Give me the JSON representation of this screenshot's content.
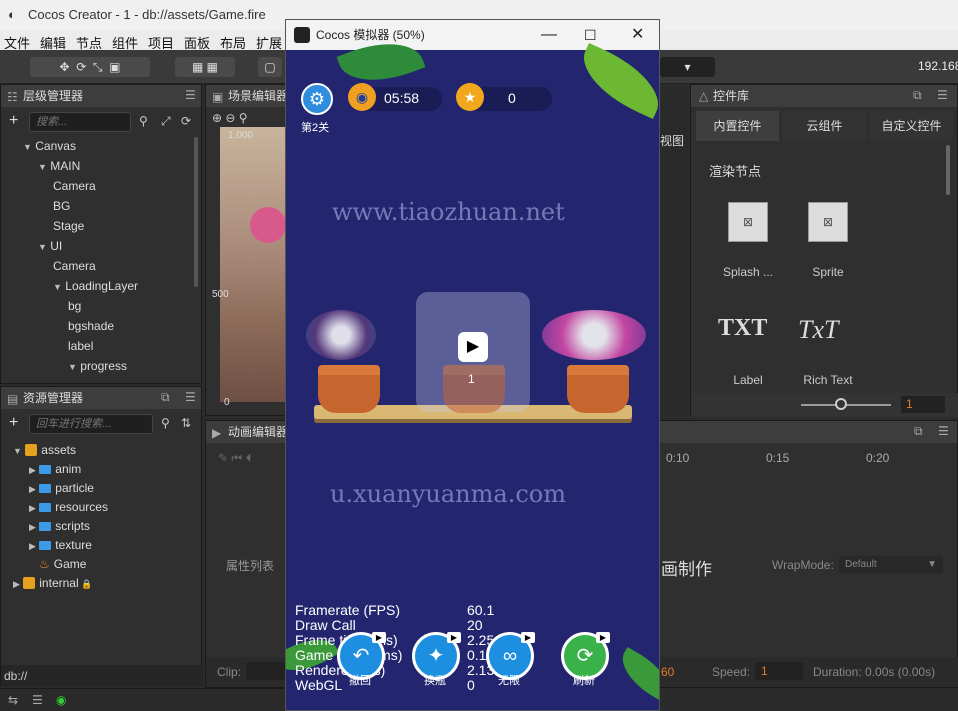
{
  "app": {
    "title": "Cocos Creator - 1 - db://assets/Game.fire",
    "ip": "192.168"
  },
  "menu": [
    "文件",
    "编辑",
    "节点",
    "组件",
    "项目",
    "面板",
    "布局",
    "扩展"
  ],
  "hierarchy": {
    "title": "层级管理器",
    "search_placeholder": "搜索...",
    "items": [
      {
        "label": "Canvas",
        "depth": 0,
        "open": true
      },
      {
        "label": "MAIN",
        "depth": 1,
        "open": true
      },
      {
        "label": "Camera",
        "depth": 2
      },
      {
        "label": "BG",
        "depth": 2
      },
      {
        "label": "Stage",
        "depth": 2
      },
      {
        "label": "UI",
        "depth": 1,
        "open": true
      },
      {
        "label": "Camera",
        "depth": 2
      },
      {
        "label": "LoadingLayer",
        "depth": 2,
        "open": true
      },
      {
        "label": "bg",
        "depth": 3
      },
      {
        "label": "bgshade",
        "depth": 3
      },
      {
        "label": "label",
        "depth": 3
      },
      {
        "label": "progress",
        "depth": 3,
        "open": true
      }
    ]
  },
  "scene": {
    "title": "场景编辑器",
    "ruler": [
      "1,000",
      "500",
      "0"
    ],
    "right_tab": "视图"
  },
  "assets": {
    "title": "资源管理器",
    "search_placeholder": "回车进行搜索...",
    "items": [
      {
        "label": "assets",
        "depth": 0,
        "type": "db",
        "open": true
      },
      {
        "label": "anim",
        "depth": 1,
        "type": "folder"
      },
      {
        "label": "particle",
        "depth": 1,
        "type": "folder"
      },
      {
        "label": "resources",
        "depth": 1,
        "type": "folder"
      },
      {
        "label": "scripts",
        "depth": 1,
        "type": "folder"
      },
      {
        "label": "texture",
        "depth": 1,
        "type": "folder"
      },
      {
        "label": "Game",
        "depth": 1,
        "type": "fire"
      },
      {
        "label": "internal",
        "depth": 0,
        "type": "db-locked"
      }
    ],
    "footer": "db://"
  },
  "animation": {
    "title": "动画编辑器",
    "props": "属性列表",
    "ticks": [
      "0:10",
      "0:15",
      "0:20"
    ],
    "make": "画制作",
    "wrapmode_label": "WrapMode:",
    "wrapmode": "Default",
    "clip_label": "Clip:",
    "sample": "60",
    "speed_label": "Speed:",
    "speed": "1",
    "duration": "Duration: 0.00s (0.00s)"
  },
  "controls": {
    "title": "控件库",
    "tabs": [
      "内置控件",
      "云组件",
      "自定义控件"
    ],
    "section": "渲染节点",
    "widgets": [
      {
        "label": "Splash ..."
      },
      {
        "label": "Sprite"
      },
      {
        "label": "Label",
        "glyph": "TXT"
      },
      {
        "label": "Rich Text",
        "glyph": "TxT"
      }
    ],
    "zoom": "1"
  },
  "sim": {
    "title": "Cocos 模拟器 (50%)",
    "level": "第2关",
    "timer": "05:58",
    "coins": "0",
    "watermark1": "www.tiaozhuan.net",
    "watermark2": "u.xuanyuanma.com",
    "lock_count": "1",
    "stats": [
      {
        "label": "Framerate (FPS)",
        "value": "60.1"
      },
      {
        "label": "Draw Call",
        "value": "20"
      },
      {
        "label": "Frame time (ms)",
        "value": "2.25"
      },
      {
        "label": "Game Logic (ms)",
        "value": "0.12"
      },
      {
        "label": "Renderer (ms)",
        "value": "2.13"
      },
      {
        "label": "WebGL",
        "value": "0"
      }
    ],
    "buttons": [
      "撤回",
      "换瓶",
      "无限",
      "刷新"
    ]
  }
}
